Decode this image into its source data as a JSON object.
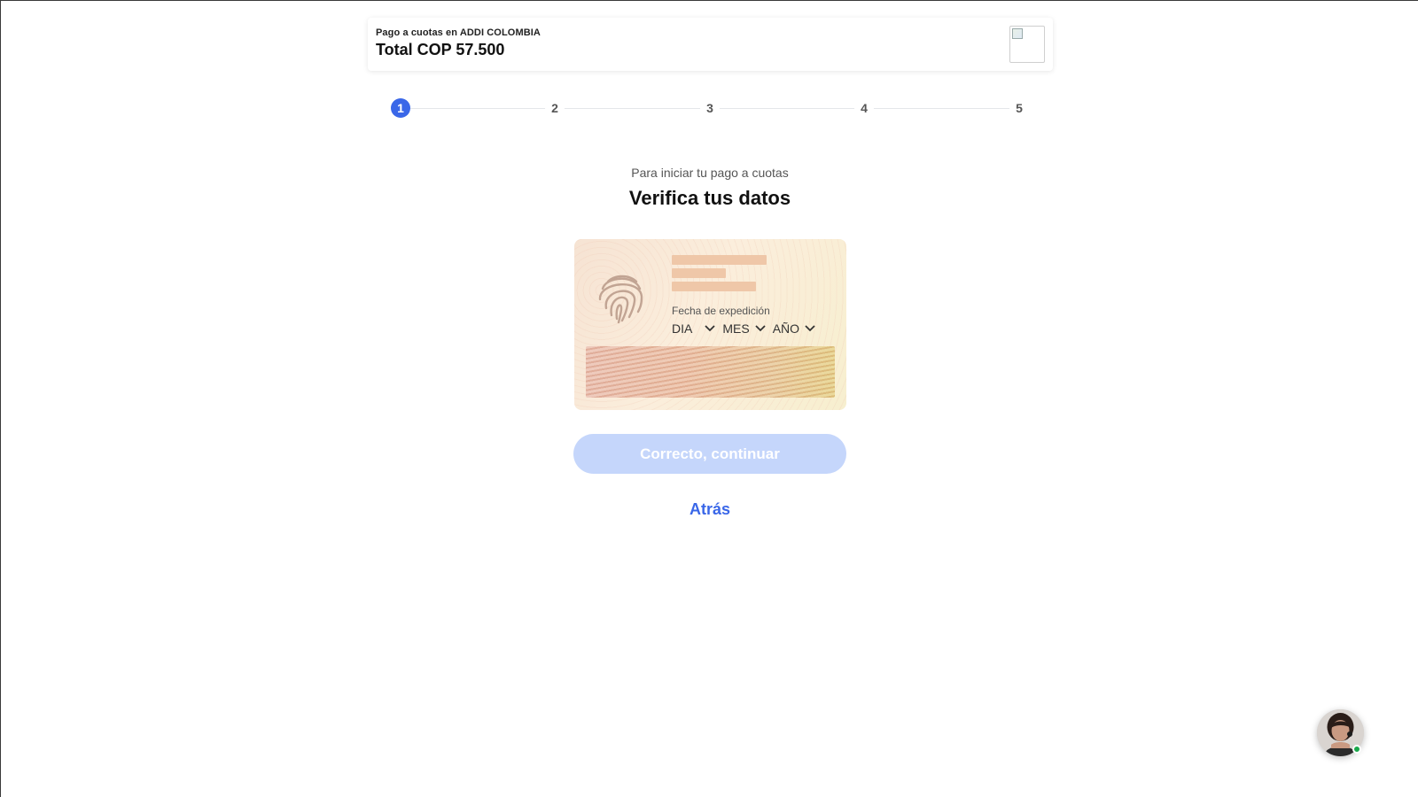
{
  "header": {
    "merchant_line": "Pago a cuotas en ADDI COLOMBIA",
    "total": "Total COP 57.500",
    "logo_icon": "merchant-logo-broken-image-icon"
  },
  "stepper": {
    "steps": [
      "1",
      "2",
      "3",
      "4",
      "5"
    ],
    "active_step": 1,
    "active_color": "#3a67e8"
  },
  "main": {
    "subtitle": "Para iniciar tu pago a cuotas",
    "title": "Verifica tus datos"
  },
  "id_card": {
    "fingerprint_icon": "fingerprint-icon",
    "issue_date_label": "Fecha de expedición",
    "day_select": "DIA",
    "month_select": "MES",
    "year_select": "AÑO"
  },
  "actions": {
    "continue_label": "Correcto, continuar",
    "continue_color": "#c5d6fb",
    "back_label": "Atrás",
    "link_color": "#3a67e8"
  },
  "chat": {
    "avatar_icon": "support-agent-avatar",
    "status_color": "#1aa84b"
  }
}
